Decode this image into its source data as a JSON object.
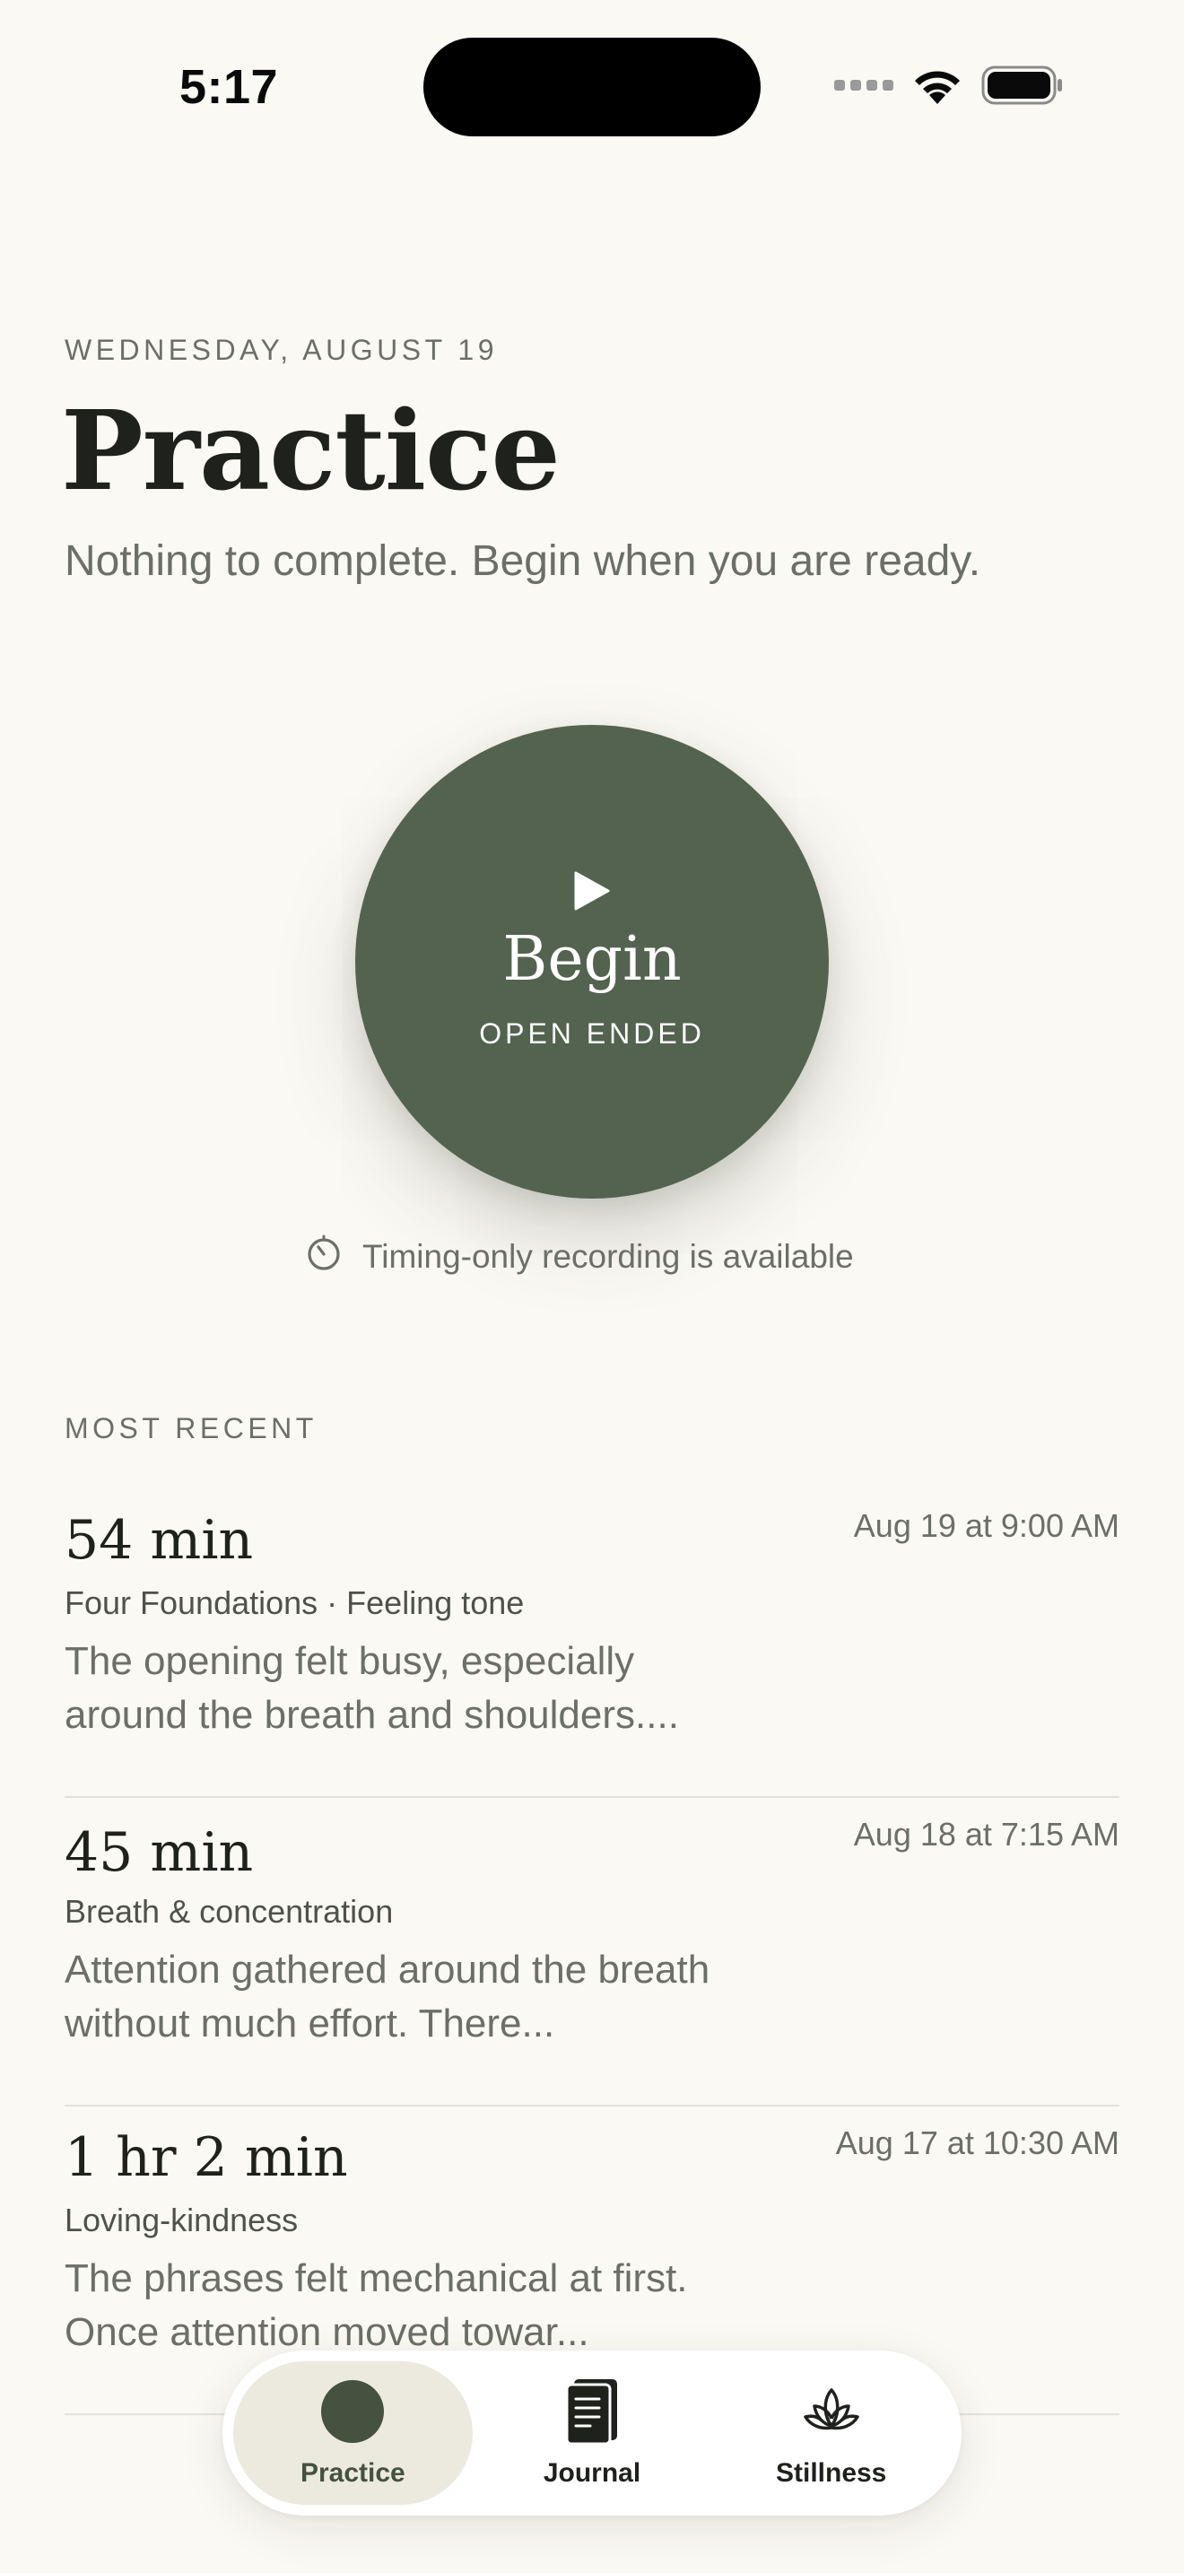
{
  "status_bar": {
    "time": "5:17"
  },
  "header": {
    "date": "WEDNESDAY, AUGUST 19",
    "title": "Practice",
    "subtitle": "Nothing to complete. Begin when you are ready."
  },
  "begin": {
    "label": "Begin",
    "mode": "OPEN ENDED",
    "color": "#53634F"
  },
  "timing_note": "Timing-only recording is available",
  "recent": {
    "section_label": "MOST RECENT",
    "sessions": [
      {
        "duration": "54 min",
        "timestamp": "Aug 19 at 9:00 AM",
        "tags": "Four Foundations · Feeling tone",
        "note": "The opening felt busy, especially around the breath and shoulders...."
      },
      {
        "duration": "45 min",
        "timestamp": "Aug 18 at 7:15 AM",
        "tags": "Breath & concentration",
        "note": "Attention gathered around the breath without much effort. There..."
      },
      {
        "duration": "1 hr 2 min",
        "timestamp": "Aug 17 at 10:30 AM",
        "tags": "Loving-kindness",
        "note": "The phrases felt mechanical at first. Once attention moved towar..."
      }
    ]
  },
  "tab_bar": {
    "tabs": [
      {
        "label": "Practice",
        "icon": "practice-dot-icon",
        "active": true
      },
      {
        "label": "Journal",
        "icon": "journal-icon",
        "active": false
      },
      {
        "label": "Stillness",
        "icon": "lotus-icon",
        "active": false
      }
    ]
  },
  "colors": {
    "background": "#FBF9F3",
    "accent": "#53634F",
    "text_primary": "#1F221C",
    "text_secondary": "#6C6F67"
  }
}
